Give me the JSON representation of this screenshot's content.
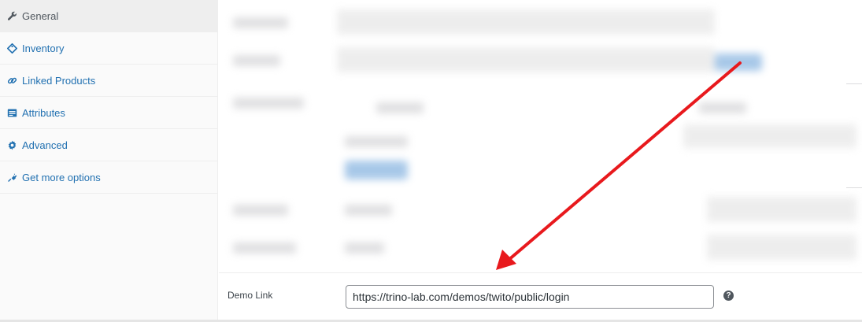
{
  "sidebar": {
    "items": [
      {
        "label": "General",
        "icon": "wrench-icon",
        "active": true
      },
      {
        "label": "Inventory",
        "icon": "tag-icon",
        "active": false
      },
      {
        "label": "Linked Products",
        "icon": "link-icon",
        "active": false
      },
      {
        "label": "Attributes",
        "icon": "list-icon",
        "active": false
      },
      {
        "label": "Advanced",
        "icon": "gear-icon",
        "active": false
      },
      {
        "label": "Get more options",
        "icon": "plugin-icon",
        "active": false
      }
    ]
  },
  "demo_field": {
    "label": "Demo Link",
    "value": "https://trino-lab.com/demos/twito/public/login",
    "help": "?"
  },
  "colors": {
    "link": "#2271b1",
    "annotation_arrow": "#e8191d"
  }
}
